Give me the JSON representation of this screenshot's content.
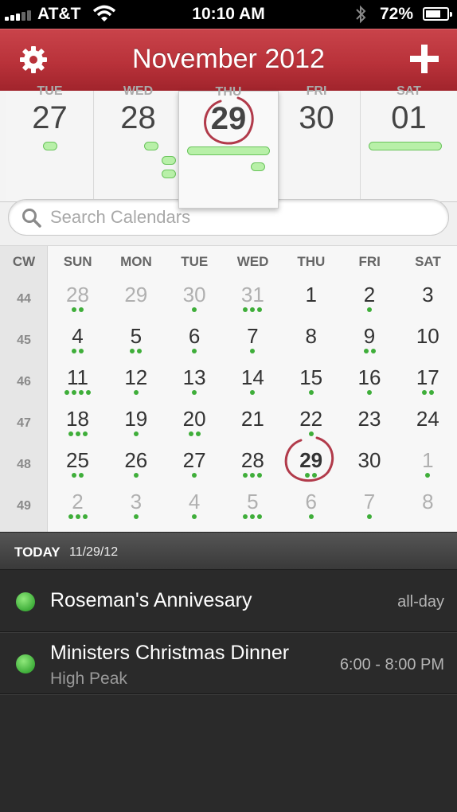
{
  "status_bar": {
    "carrier": "AT&T",
    "time": "10:10 AM",
    "battery": "72%",
    "battery_level": 0.72
  },
  "header": {
    "title": "November 2012",
    "settings_icon": "gear-icon",
    "add_icon": "plus-icon"
  },
  "week_strip": {
    "days": [
      {
        "name": "TUE",
        "num": "27"
      },
      {
        "name": "WED",
        "num": "28"
      },
      {
        "name": "THU",
        "num": "29"
      },
      {
        "name": "FRI",
        "num": "30"
      },
      {
        "name": "SAT",
        "num": "01"
      }
    ]
  },
  "search": {
    "placeholder": "Search Calendars"
  },
  "month": {
    "cw_label": "CW",
    "weekdays": [
      "SUN",
      "MON",
      "TUE",
      "WED",
      "THU",
      "FRI",
      "SAT"
    ],
    "weeks": [
      {
        "cw": "44",
        "days": [
          {
            "d": "28",
            "other": true,
            "dots": 2
          },
          {
            "d": "29",
            "other": true,
            "dots": 0
          },
          {
            "d": "30",
            "other": true,
            "dots": 1
          },
          {
            "d": "31",
            "other": true,
            "dots": 3
          },
          {
            "d": "1",
            "dots": 0
          },
          {
            "d": "2",
            "dots": 1
          },
          {
            "d": "3",
            "dots": 0
          }
        ]
      },
      {
        "cw": "45",
        "days": [
          {
            "d": "4",
            "dots": 2
          },
          {
            "d": "5",
            "dots": 2
          },
          {
            "d": "6",
            "dots": 1
          },
          {
            "d": "7",
            "dots": 1
          },
          {
            "d": "8",
            "dots": 0
          },
          {
            "d": "9",
            "dots": 2
          },
          {
            "d": "10",
            "dots": 0
          }
        ]
      },
      {
        "cw": "46",
        "days": [
          {
            "d": "11",
            "dots": 4
          },
          {
            "d": "12",
            "dots": 1
          },
          {
            "d": "13",
            "dots": 1
          },
          {
            "d": "14",
            "dots": 1
          },
          {
            "d": "15",
            "dots": 1
          },
          {
            "d": "16",
            "dots": 1
          },
          {
            "d": "17",
            "dots": 2
          }
        ]
      },
      {
        "cw": "47",
        "days": [
          {
            "d": "18",
            "dots": 3
          },
          {
            "d": "19",
            "dots": 1
          },
          {
            "d": "20",
            "dots": 2
          },
          {
            "d": "21",
            "dots": 0
          },
          {
            "d": "22",
            "dots": 1
          },
          {
            "d": "23",
            "dots": 0
          },
          {
            "d": "24",
            "dots": 0
          }
        ]
      },
      {
        "cw": "48",
        "days": [
          {
            "d": "25",
            "dots": 2
          },
          {
            "d": "26",
            "dots": 1
          },
          {
            "d": "27",
            "dots": 1
          },
          {
            "d": "28",
            "dots": 3
          },
          {
            "d": "29",
            "today": true,
            "dots": 2
          },
          {
            "d": "30",
            "dots": 0
          },
          {
            "d": "1",
            "other": true,
            "dots": 1
          }
        ]
      },
      {
        "cw": "49",
        "days": [
          {
            "d": "2",
            "other": true,
            "dots": 3
          },
          {
            "d": "3",
            "other": true,
            "dots": 1
          },
          {
            "d": "4",
            "other": true,
            "dots": 1
          },
          {
            "d": "5",
            "other": true,
            "dots": 3
          },
          {
            "d": "6",
            "other": true,
            "dots": 1
          },
          {
            "d": "7",
            "other": true,
            "dots": 1
          },
          {
            "d": "8",
            "other": true,
            "dots": 0
          }
        ]
      }
    ]
  },
  "agenda": {
    "label": "TODAY",
    "date": "11/29/12",
    "events": [
      {
        "title": "Roseman's Annivesary",
        "subtitle": "",
        "time": "all-day",
        "color": "#3fae3a"
      },
      {
        "title": "Ministers Christmas Dinner",
        "subtitle": "High Peak",
        "time": "6:00 - 8:00 PM",
        "color": "#3fae3a"
      }
    ]
  },
  "colors": {
    "header_red": "#b9323a",
    "event_green": "#3fae3a",
    "today_ring": "#b13a4a"
  }
}
